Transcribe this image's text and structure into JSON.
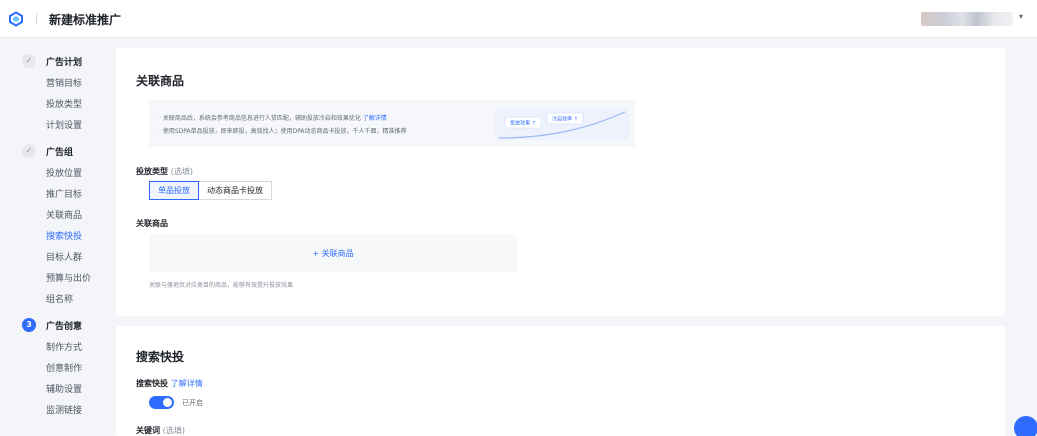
{
  "header": {
    "title": "新建标准推广",
    "colors": {
      "primary": "#2f6bff"
    }
  },
  "sidebar": {
    "steps": [
      {
        "badge": "✓",
        "label": "广告计划",
        "items": [
          "营销目标",
          "投放类型",
          "计划设置"
        ]
      },
      {
        "badge": "✓",
        "label": "广告组",
        "items": [
          "投放位置",
          "推广目标",
          "关联商品",
          "搜索快投",
          "目标人群",
          "预算与出价",
          "组名称"
        ]
      },
      {
        "badge": "3",
        "label": "广告创意",
        "items": [
          "制作方式",
          "创意制作",
          "辅助设置",
          "监测链接"
        ]
      }
    ],
    "current_item": "搜索快投"
  },
  "related_products": {
    "title": "关联商品",
    "info": {
      "line1": "· 关联商品后，系统会参考商品信息进行人货匹配，辅助投放冷启和效果优化",
      "line1_link": "了解详情",
      "line2": "· 使用SDPA单品投放，即来即投，高效找人；使用DPA动态商品卡投放，千人千面，精准推荐",
      "graphic_label1": "投放效果 ↑",
      "graphic_label2": "冷启效率 ↑"
    },
    "delivery_type_label": "投放类型",
    "delivery_type_optional": "(选填)",
    "delivery_options": [
      "单品投放",
      "动态商品卡投放"
    ],
    "selected_option": "单品投放",
    "product_label": "关联商品",
    "add_product": "+ 关联商品",
    "hint": "关联与落地页对应类目的商品，能够有效提升投放效果"
  },
  "search_express": {
    "title": "搜索快投",
    "label": "搜索快投",
    "learn_more": "了解详情",
    "toggle_on": true,
    "toggle_text": "已开启",
    "keywords_label": "关键词",
    "keywords_optional": "(选填)"
  }
}
